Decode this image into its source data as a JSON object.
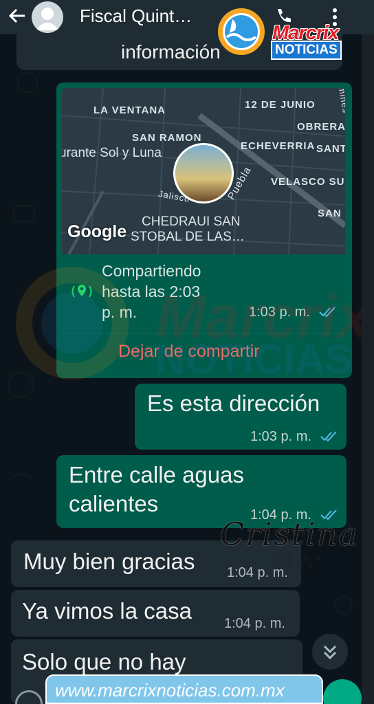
{
  "header": {
    "title": "Fiscal Quint…",
    "back_icon": "arrow-left-icon",
    "phone_icon": "phone-icon",
    "menu_icon": "more-vert-icon"
  },
  "logo": {
    "brand": "Marcrix",
    "sub": "NOTICIAS"
  },
  "partial_message": {
    "text": "información"
  },
  "location_card": {
    "map_labels": [
      "LA VENTANA",
      "12 DE JUNIO",
      "OBRERA",
      "SAN RAMON",
      "ECHEVERRIA",
      "SANT",
      "urante Sol y Luna",
      "VELASCO SUA",
      "SAN",
      "CHEDRAUI SAN",
      "STOBAL DE LAS…",
      "Puebla",
      "Jalisco",
      "zmines"
    ],
    "map_attribution": "Google",
    "sharing_line1": "Compartiendo",
    "sharing_line2": "hasta las 2:03",
    "sharing_line3": "p. m.",
    "time": "1:03 p. m.",
    "stop_label": "Dejar de compartir"
  },
  "messages": [
    {
      "side": "out",
      "lines": [
        "Es esta dirección"
      ],
      "time": "1:03 p. m."
    },
    {
      "side": "out",
      "lines": [
        "Entre calle aguas",
        "calientes"
      ],
      "time": "1:04 p. m."
    },
    {
      "side": "in",
      "lines": [
        "Muy bien gracias"
      ],
      "time": "1:04 p. m."
    },
    {
      "side": "in",
      "lines": [
        "Ya vimos la casa"
      ],
      "time": "1:04 p. m."
    },
    {
      "side": "in",
      "lines": [
        "Solo que no hay"
      ],
      "time": ""
    }
  ],
  "watermarks": {
    "center": "Marcrix",
    "center_sub": "NOTICIAS",
    "signature": "Cristina",
    "signature_top": "MARIA",
    "signature_bottom": "DE LA CRUZ"
  },
  "footer": {
    "url": "www.marcrixnoticias.com.mx"
  },
  "colors": {
    "background": "#0b141a",
    "incoming_bubble": "#1f2c34",
    "outgoing_bubble": "#005c4b",
    "read_ticks": "#53bdeb",
    "stop_share": "#ef6a6a",
    "logo_red": "#e41e26",
    "logo_blue": "#1976d2"
  }
}
